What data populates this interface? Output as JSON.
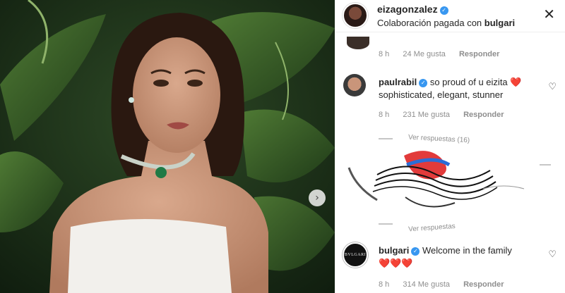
{
  "header": {
    "username": "eizagonzalez",
    "subtitle_prefix": "Colaboración pagada con",
    "subtitle_brand": "bulgari",
    "close_icon": "close-icon"
  },
  "comments": [
    {
      "id": "top",
      "time": "8 h",
      "likes": "24 Me gusta",
      "reply": "Responder"
    },
    {
      "id": "paulrabil",
      "username": "paulrabil",
      "text": "so proud of u eizita",
      "emoji": "❤️",
      "text2": "sophisticated, elegant, stunner",
      "time": "8 h",
      "likes": "231 Me gusta",
      "reply": "Responder"
    },
    {
      "id": "bulgari",
      "username": "bulgari",
      "text": "Welcome in the family",
      "emoji": "❤️❤️❤️",
      "time": "8 h",
      "likes": "314 Me gusta",
      "reply": "Responder",
      "avatar_text": "BVLGARI"
    }
  ],
  "glitch": {
    "line1": "Ver respuestas (16)",
    "line2": "Ver respuestas"
  },
  "colors": {
    "verified": "#3897f0",
    "heart": "#ed2d2d",
    "meta": "#8e8e8e"
  }
}
